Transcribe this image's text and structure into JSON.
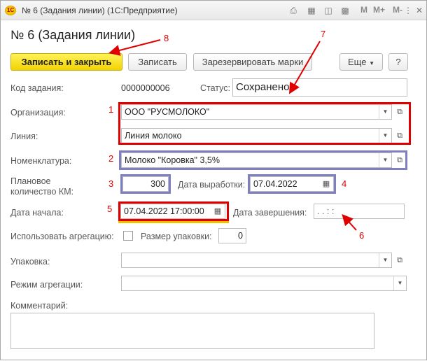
{
  "window": {
    "title": "№ 6 (Задания линии) (1С:Предприятие)",
    "memory_buttons": [
      "M",
      "M+",
      "M-"
    ]
  },
  "form": {
    "title": "№ 6 (Задания линии)"
  },
  "toolbar": {
    "save_close_label": "Записать и закрыть",
    "save_label": "Записать",
    "reserve_label": "Зарезервировать марки",
    "more_label": "Еще",
    "help_label": "?"
  },
  "fields": {
    "task_code_label": "Код задания:",
    "task_code_value": "0000000006",
    "status_label": "Статус:",
    "status_value": "Сохранено",
    "organization_label": "Организация:",
    "organization_value": "ООО \"РУСМОЛОКО\"",
    "line_label": "Линия:",
    "line_value": "Линия молоко",
    "nomenclature_label": "Номенклатура:",
    "nomenclature_value": "Молоко \"Коровка\" 3,5%",
    "planned_qty_label_1": "Плановое",
    "planned_qty_label_2": "количество КМ:",
    "planned_qty_value": "300",
    "production_date_label": "Дата выработки:",
    "production_date_value": "07.04.2022",
    "start_date_label": "Дата начала:",
    "start_date_value": "07.04.2022 17:00:00",
    "end_date_label": "Дата завершения:",
    "end_date_placeholder": " .  .     :  :",
    "use_aggregation_label": "Использовать агрегацию:",
    "package_size_label": "Размер упаковки:",
    "package_size_value": "0",
    "package_label": "Упаковка:",
    "package_value": "",
    "aggregation_mode_label": "Режим агрегации:",
    "aggregation_mode_value": "",
    "comment_label": "Комментарий:",
    "comment_value": ""
  },
  "annotations": [
    "1",
    "2",
    "3",
    "4",
    "5",
    "6",
    "7",
    "8"
  ],
  "colors": {
    "annotation_red": "#e10000",
    "annotation_blue": "#8080c0",
    "primary_button": "#f2d200"
  }
}
